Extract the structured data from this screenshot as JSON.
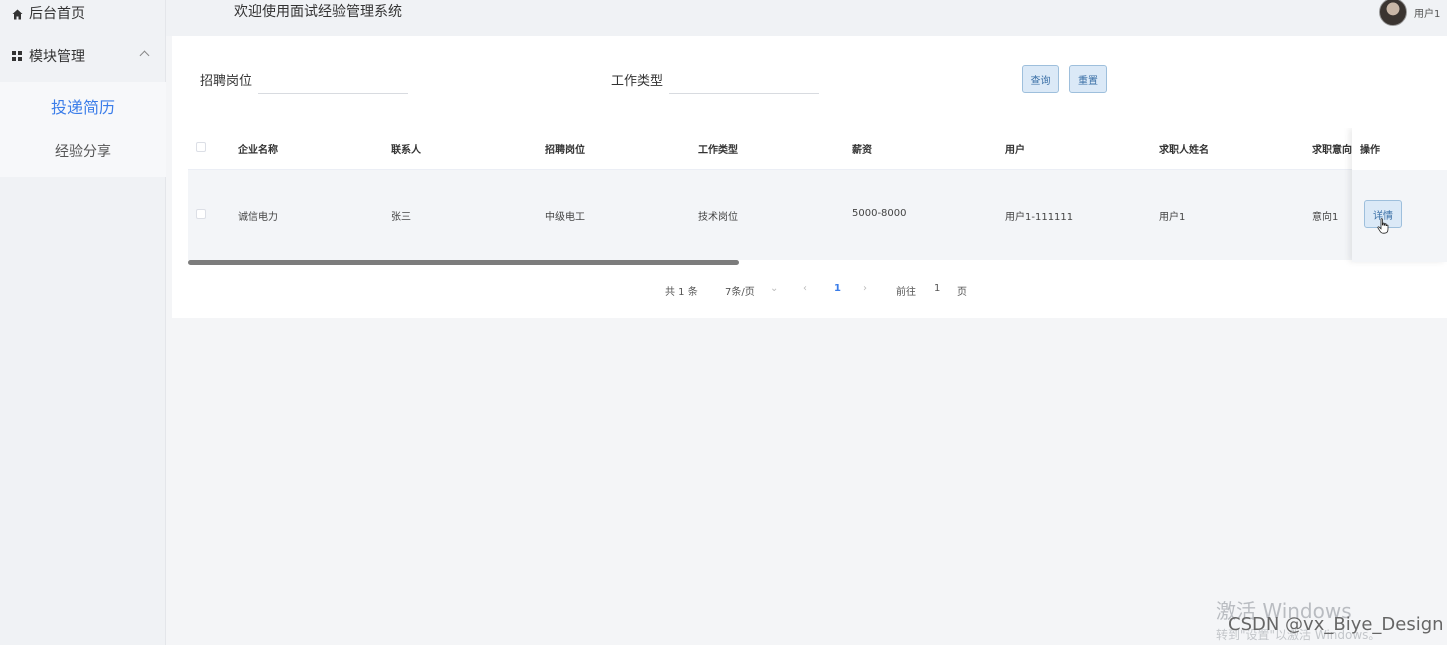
{
  "sidebar": {
    "home": "后台首页",
    "module": "模块管理",
    "items": [
      {
        "label": "投递简历"
      },
      {
        "label": "经验分享"
      }
    ]
  },
  "header": {
    "title": "欢迎使用面试经验管理系统",
    "user": "用户1"
  },
  "filters": {
    "position_label": "招聘岗位",
    "position_value": "",
    "type_label": "工作类型",
    "type_value": "",
    "search_button": "查询",
    "reset_button": "重置"
  },
  "table": {
    "columns": [
      "企业名称",
      "联系人",
      "招聘岗位",
      "工作类型",
      "薪资",
      "用户",
      "求职人姓名",
      "求职意向"
    ],
    "action_header": "操作",
    "rows": [
      {
        "cells": [
          "诚信电力",
          "张三",
          "中级电工",
          "技术岗位",
          "5000-8000",
          "用户1-111111",
          "用户1",
          "意向1"
        ],
        "action": "详情"
      }
    ]
  },
  "pagination": {
    "total": "共 1 条",
    "page_size": "7条/页",
    "current_page": "1",
    "goto_prefix": "前往",
    "goto_value": "1",
    "goto_suffix": "页"
  },
  "overlay": {
    "watermark_title": "激活 Windows",
    "watermark_sub": "转到\"设置\"以激活 Windows。",
    "csdn": "CSDN @vx_Biye_Design"
  }
}
